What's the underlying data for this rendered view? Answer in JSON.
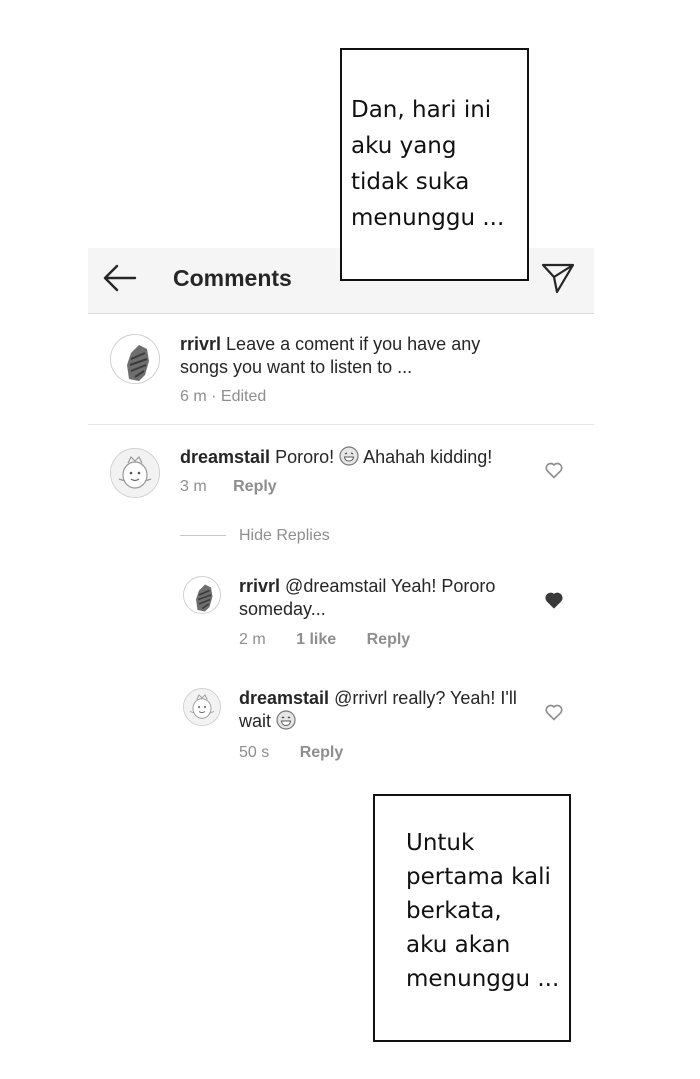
{
  "header": {
    "title": "Comments",
    "back_icon": "arrow-left-icon",
    "send_icon": "paper-plane-icon"
  },
  "captions": {
    "top": [
      "Dan, hari ini",
      "aku yang",
      "tidak suka",
      "menunggu ..."
    ],
    "bottom": [
      "Untuk",
      "pertama kali",
      "berkata,",
      "aku akan",
      "menunggu ..."
    ]
  },
  "caption_meta": {
    "top_emoji": "grinning-face-icon",
    "wink_emoji": "smiling-face-icon"
  },
  "post": {
    "username": "rrivrl",
    "text": "Leave a coment if you have any songs you want to listen to ...",
    "time": "6 m · Edited"
  },
  "comments": [
    {
      "username": "dreamstail",
      "text_before": "Pororo!",
      "text_after": "Ahahah kidding!",
      "time": "3 m",
      "reply_label": "Reply",
      "liked": false
    }
  ],
  "hide_replies_label": "Hide Replies",
  "replies": [
    {
      "username": "rrivrl",
      "text": "@dreamstail Yeah! Pororo someday...",
      "time": "2 m",
      "likes_label": "1 like",
      "reply_label": "Reply",
      "liked": true
    },
    {
      "username": "dreamstail",
      "text_before": "@rrivrl really? Yeah! I'll wait",
      "time": "50 s",
      "reply_label": "Reply",
      "liked": false
    }
  ],
  "colors": {
    "header_bg": "#f5f5f5",
    "meta_gray": "#8e8e8e",
    "text": "#262626"
  }
}
